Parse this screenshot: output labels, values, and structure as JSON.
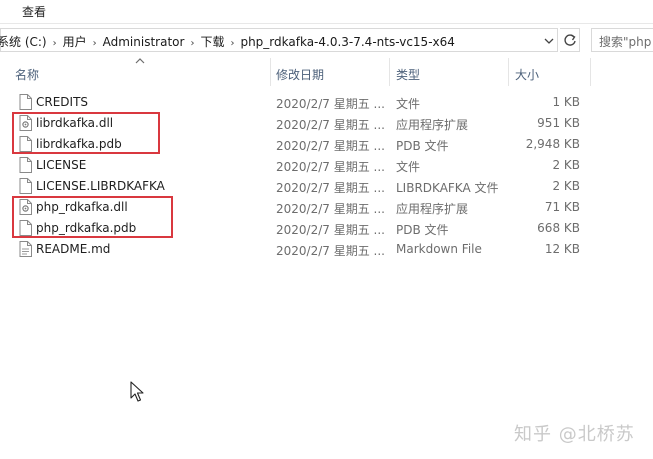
{
  "ribbon": {
    "tab_view": "查看"
  },
  "address": {
    "crumbs": [
      "系统 (C:)",
      "用户",
      "Administrator",
      "下载",
      "php_rdkafka-4.0.3-7.4-nts-vc15-x64"
    ],
    "search_placeholder": "搜索\"php"
  },
  "columns": {
    "name": "名称",
    "date": "修改日期",
    "type": "类型",
    "size": "大小"
  },
  "files": [
    {
      "name": "CREDITS",
      "date": "2020/2/7 星期五 ...",
      "type": "文件",
      "size": "1 KB",
      "icon": "document-icon"
    },
    {
      "name": "librdkafka.dll",
      "date": "2020/2/7 星期五 ...",
      "type": "应用程序扩展",
      "size": "951 KB",
      "icon": "dll-icon"
    },
    {
      "name": "librdkafka.pdb",
      "date": "2020/2/7 星期五 ...",
      "type": "PDB 文件",
      "size": "2,948 KB",
      "icon": "document-icon"
    },
    {
      "name": "LICENSE",
      "date": "2020/2/7 星期五 ...",
      "type": "文件",
      "size": "2 KB",
      "icon": "document-icon"
    },
    {
      "name": "LICENSE.LIBRDKAFKA",
      "date": "2020/2/7 星期五 ...",
      "type": "LIBRDKAFKA 文件",
      "size": "2 KB",
      "icon": "document-icon"
    },
    {
      "name": "php_rdkafka.dll",
      "date": "2020/2/7 星期五 ...",
      "type": "应用程序扩展",
      "size": "71 KB",
      "icon": "dll-icon"
    },
    {
      "name": "php_rdkafka.pdb",
      "date": "2020/2/7 星期五 ...",
      "type": "PDB 文件",
      "size": "668 KB",
      "icon": "document-icon"
    },
    {
      "name": "README.md",
      "date": "2020/2/7 星期五 ...",
      "type": "Markdown File",
      "size": "12 KB",
      "icon": "markdown-icon"
    }
  ],
  "watermark": "知乎 @北桥苏",
  "colors": {
    "highlight": "#d9383f",
    "header_text": "#4c607a"
  }
}
